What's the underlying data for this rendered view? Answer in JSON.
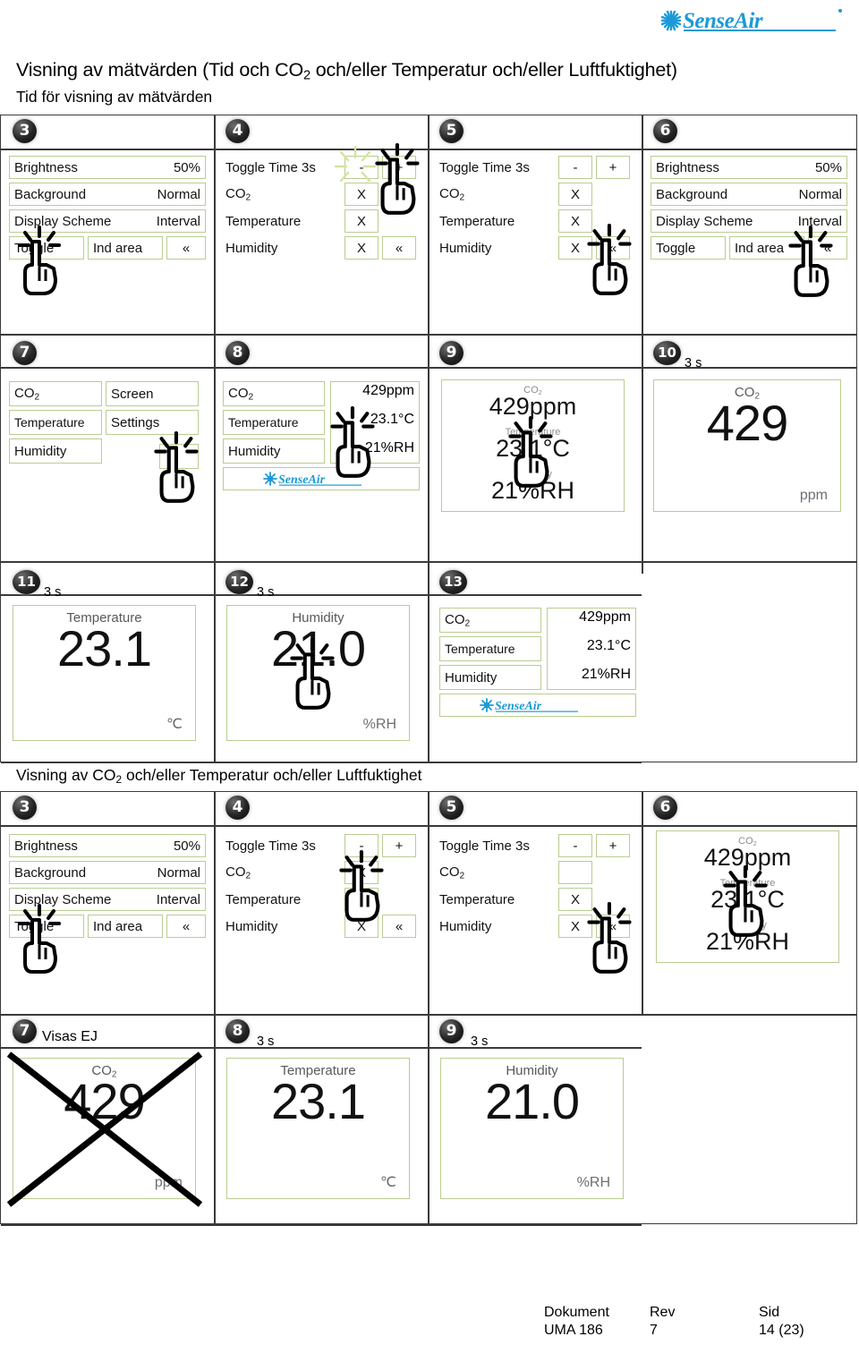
{
  "brand": {
    "name": "SenseAir",
    "logo_color": "#1c9ad6"
  },
  "headings": {
    "section1_title_pre": "Visning av mätvärden (Tid och CO",
    "section1_title_sub": "2",
    "section1_title_post": " och/eller Temperatur och/eller Luftfuktighet)",
    "section1_subtitle": "Tid för visning av mätvärden",
    "section2_title_pre": "Visning av CO",
    "section2_title_sub": "2",
    "section2_title_post": " och/eller Temperatur och/eller Luftfuktighet"
  },
  "labels": {
    "brightness": "Brightness",
    "brightness_value": "50%",
    "background": "Background",
    "background_value": "Normal",
    "display_scheme": "Display Scheme",
    "display_scheme_value": "Interval",
    "toggle": "Toggle",
    "ind_area": "Ind area",
    "back_chevron": "«",
    "toggle_time": "Toggle Time 3s",
    "minus": "-",
    "plus": "+",
    "co2": "CO",
    "co2_sub": "2",
    "temperature": "Temperature",
    "humidity": "Humidity",
    "x_mark": "X",
    "screen": "Screen",
    "settings": "Settings",
    "ppm_value": "429ppm",
    "temp_value": "23.1°C",
    "hum_value": "21%RH",
    "co2_number": "429",
    "ppm_unit": "ppm",
    "temp_number": "23.1",
    "temp_unit": "℃",
    "hum_number": "21.0",
    "hum_unit": "%RH",
    "timing_3s": "3 s",
    "visas_ej": "Visas EJ"
  },
  "section1": {
    "panels": [
      {
        "num": "3",
        "note": ""
      },
      {
        "num": "4",
        "note": ""
      },
      {
        "num": "5",
        "note": ""
      },
      {
        "num": "6",
        "note": ""
      },
      {
        "num": "7",
        "note": ""
      },
      {
        "num": "8",
        "note": ""
      },
      {
        "num": "9",
        "note": ""
      },
      {
        "num": "10",
        "note": "3 s"
      },
      {
        "num": "11",
        "note": "3 s"
      },
      {
        "num": "12",
        "note": "3 s"
      },
      {
        "num": "13",
        "note": ""
      }
    ]
  },
  "section2": {
    "panels": [
      {
        "num": "3",
        "note": ""
      },
      {
        "num": "4",
        "note": ""
      },
      {
        "num": "5",
        "note": ""
      },
      {
        "num": "6",
        "note": ""
      },
      {
        "num": "7",
        "note": "Visas EJ"
      },
      {
        "num": "8",
        "note": "3 s"
      },
      {
        "num": "9",
        "note": "3 s"
      }
    ]
  },
  "footer": {
    "col1_head": "Dokument",
    "col1_val": "UMA 186",
    "col2_head": "Rev",
    "col2_val": "7",
    "col3_head": "Sid",
    "col3_val": "14 (23)"
  }
}
